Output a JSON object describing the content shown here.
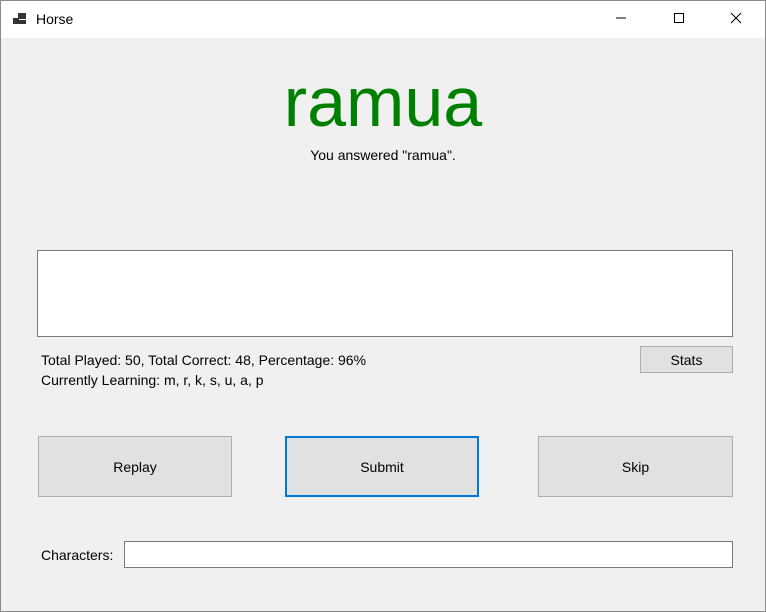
{
  "window": {
    "title": "Horse",
    "app_icon": "window-app-icon",
    "controls": {
      "minimize_icon": "minimize-icon",
      "maximize_icon": "maximize-icon",
      "close_icon": "close-icon"
    }
  },
  "answer": {
    "word": "ramua",
    "word_color": "#008000",
    "feedback": "You answered \"ramua\"."
  },
  "output_box": {
    "value": ""
  },
  "stats": {
    "line1": "Total Played: 50, Total Correct: 48, Percentage: 96%",
    "line2": "Currently Learning: m, r, k, s, u, a, p",
    "button_label": "Stats"
  },
  "actions": {
    "replay_label": "Replay",
    "submit_label": "Submit",
    "skip_label": "Skip",
    "focus_color": "#0078d7"
  },
  "characters": {
    "label": "Characters:",
    "value": ""
  }
}
